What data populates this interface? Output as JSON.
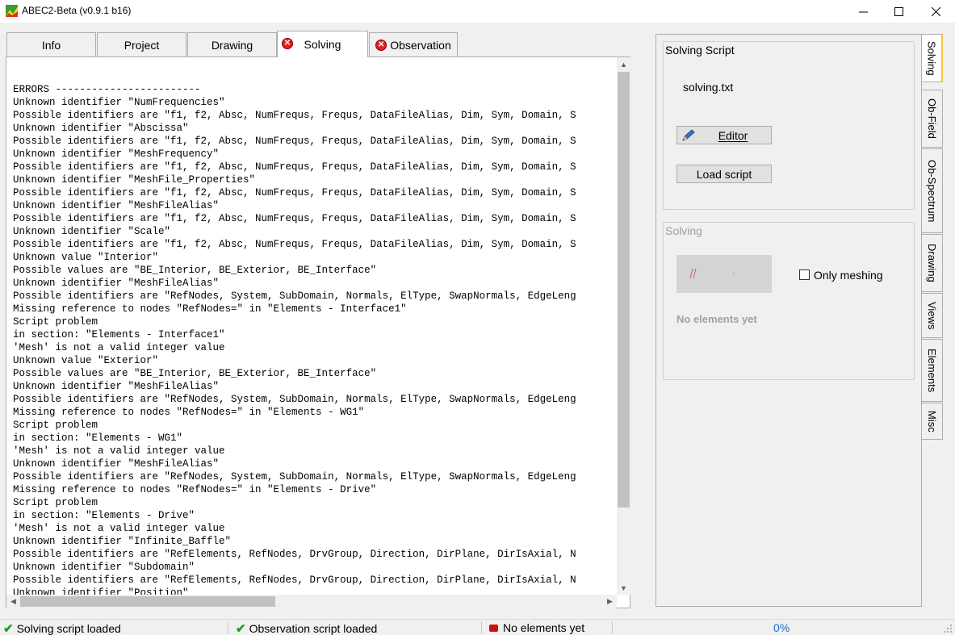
{
  "window": {
    "title": "ABEC2-Beta (v0.9.1 b16)",
    "minimize_glyph": "—",
    "maximize_glyph": "☐",
    "close_glyph": "✕"
  },
  "tabs": [
    {
      "label": "Info"
    },
    {
      "label": "Project"
    },
    {
      "label": "Drawing"
    },
    {
      "label": "Solving",
      "has_error": true,
      "active": true
    },
    {
      "label": "Observation",
      "has_error": true
    }
  ],
  "log_lines": [
    "ERRORS ------------------------",
    "Unknown identifier \"NumFrequencies\"",
    "Possible identifiers are \"f1, f2, Absc, NumFrequs, Frequs, DataFileAlias, Dim, Sym, Domain, S",
    "Unknown identifier \"Abscissa\"",
    "Possible identifiers are \"f1, f2, Absc, NumFrequs, Frequs, DataFileAlias, Dim, Sym, Domain, S",
    "Unknown identifier \"MeshFrequency\"",
    "Possible identifiers are \"f1, f2, Absc, NumFrequs, Frequs, DataFileAlias, Dim, Sym, Domain, S",
    "Unknown identifier \"MeshFile_Properties\"",
    "Possible identifiers are \"f1, f2, Absc, NumFrequs, Frequs, DataFileAlias, Dim, Sym, Domain, S",
    "Unknown identifier \"MeshFileAlias\"",
    "Possible identifiers are \"f1, f2, Absc, NumFrequs, Frequs, DataFileAlias, Dim, Sym, Domain, S",
    "Unknown identifier \"Scale\"",
    "Possible identifiers are \"f1, f2, Absc, NumFrequs, Frequs, DataFileAlias, Dim, Sym, Domain, S",
    "Unknown value \"Interior\"",
    "Possible values are \"BE_Interior, BE_Exterior, BE_Interface\"",
    "Unknown identifier \"MeshFileAlias\"",
    "Possible identifiers are \"RefNodes, System, SubDomain, Normals, ElType, SwapNormals, EdgeLeng",
    "Missing reference to nodes \"RefNodes=\" in \"Elements - Interface1\"",
    "Script problem",
    "in section: \"Elements - Interface1\"",
    "'Mesh' is not a valid integer value",
    "Unknown value \"Exterior\"",
    "Possible values are \"BE_Interior, BE_Exterior, BE_Interface\"",
    "Unknown identifier \"MeshFileAlias\"",
    "Possible identifiers are \"RefNodes, System, SubDomain, Normals, ElType, SwapNormals, EdgeLeng",
    "Missing reference to nodes \"RefNodes=\" in \"Elements - WG1\"",
    "Script problem",
    "in section: \"Elements - WG1\"",
    "'Mesh' is not a valid integer value",
    "Unknown identifier \"MeshFileAlias\"",
    "Possible identifiers are \"RefNodes, System, SubDomain, Normals, ElType, SwapNormals, EdgeLeng",
    "Missing reference to nodes \"RefNodes=\" in \"Elements - Drive\"",
    "Script problem",
    "in section: \"Elements - Drive\"",
    "'Mesh' is not a valid integer value",
    "Unknown identifier \"Infinite_Baffle\"",
    "Possible identifiers are \"RefElements, RefNodes, DrvGroup, Direction, DirPlane, DirIsAxial, N",
    "Unknown identifier \"Subdomain\"",
    "Possible identifiers are \"RefElements, RefNodes, DrvGroup, Direction, DirPlane, DirIsAxial, N",
    "Unknown identifier \"Position\""
  ],
  "solving_script": {
    "title": "Solving Script",
    "filename": "solving.txt",
    "editor_label": "Editor",
    "load_label": "Load script"
  },
  "solving": {
    "title": "Solving",
    "button_label": "-",
    "only_meshing_label": "Only meshing",
    "only_meshing_checked": false,
    "no_elements": "No elements yet"
  },
  "side_tabs": [
    {
      "label": "Solving",
      "active": true
    },
    {
      "label": "Ob-Field"
    },
    {
      "label": "Ob-Spectrum"
    },
    {
      "label": "Drawing"
    },
    {
      "label": "Views"
    },
    {
      "label": "Elements"
    },
    {
      "label": "Misc"
    }
  ],
  "status": {
    "solving": "Solving script loaded",
    "observation": "Observation script loaded",
    "elements": "No elements yet",
    "progress": "0%"
  },
  "colors": {
    "error_red": "#e02020",
    "ok_green": "#1aa11a",
    "progress_blue": "#1b6ac9",
    "active_tab_marker": "#f7c240"
  }
}
